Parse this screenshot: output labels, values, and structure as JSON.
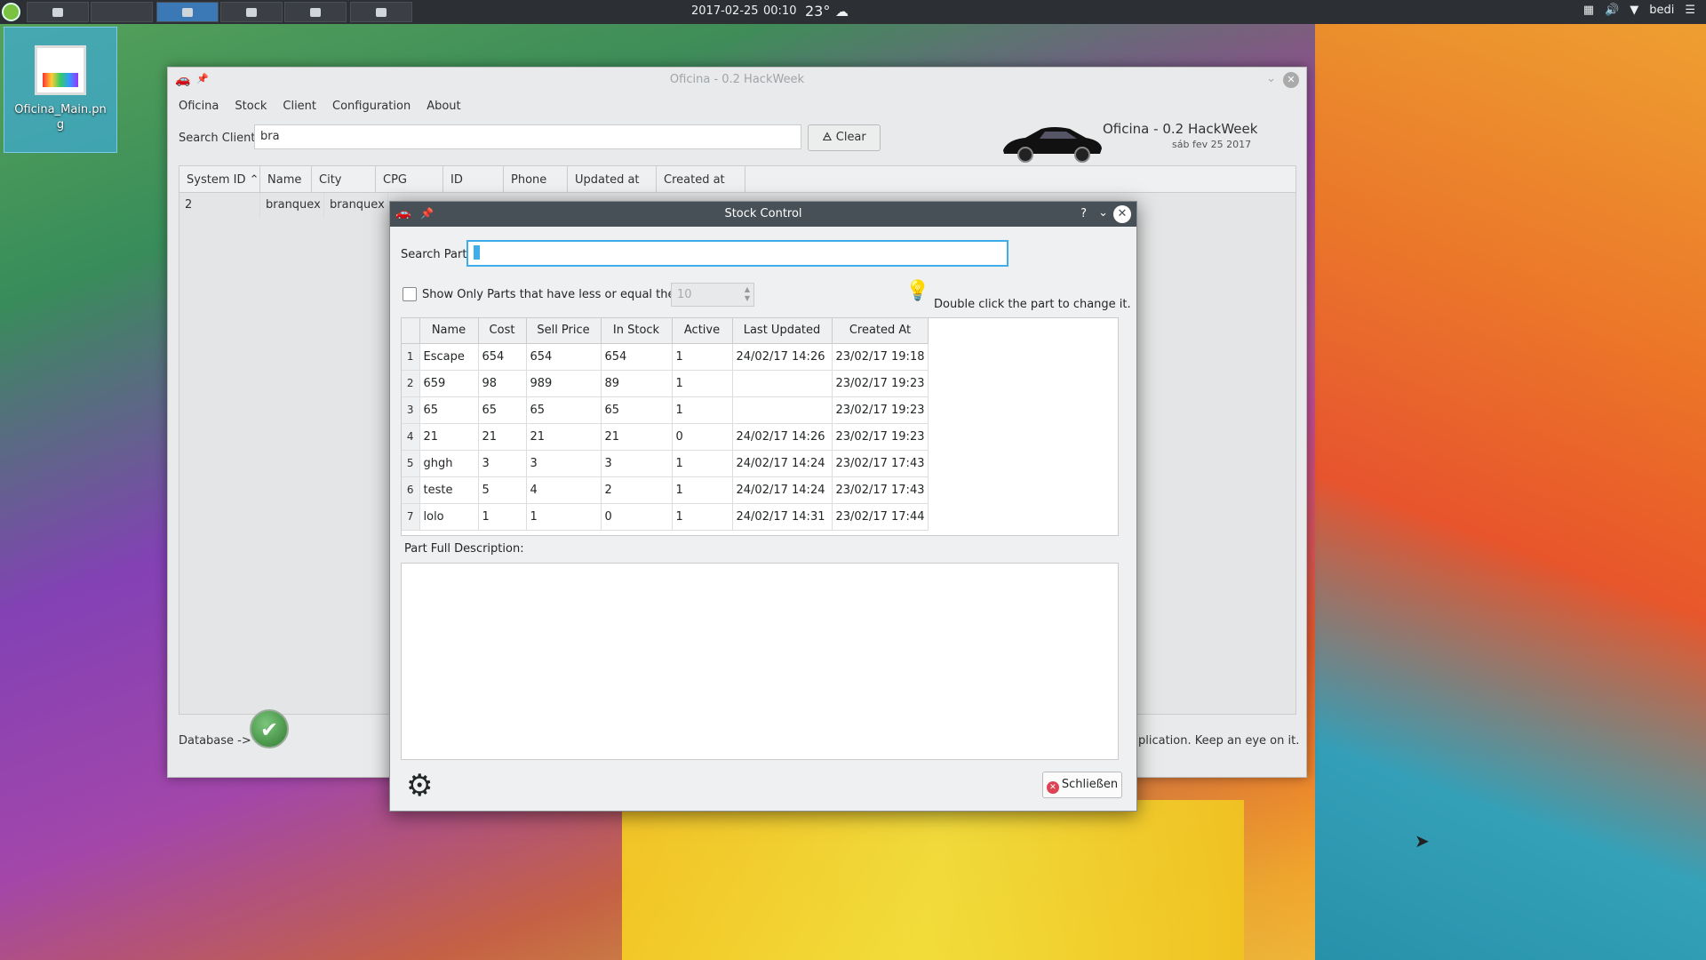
{
  "panel": {
    "date": "2017-02-25",
    "time": "00:10",
    "temperature": "23°",
    "user": "bedi"
  },
  "desktop": {
    "icon_label": "Oficina_Main.png"
  },
  "main_window": {
    "title": "Oficina - 0.2 HackWeek",
    "menu": [
      "Oficina",
      "Stock",
      "Client",
      "Configuration",
      "About"
    ],
    "search_label": "Search Client",
    "search_value": "bra",
    "clear_label": "Clear",
    "app_title": "Oficina - 0.2 HackWeek",
    "app_date": "sáb fev 25 2017",
    "client_columns": [
      "System ID",
      "Name",
      "City",
      "CPG",
      "ID",
      "Phone",
      "Updated at",
      "Created at"
    ],
    "client_rows": [
      [
        "2",
        "branquex",
        "branquex"
      ]
    ],
    "database_label": "Database ->",
    "status_message": "plication. Keep an eye on it."
  },
  "dialog": {
    "title": "Stock Control",
    "help": "?",
    "search_label": "Search Part",
    "search_value": "",
    "filter_label": "Show Only Parts that have less or equal then:",
    "filter_value": "10",
    "hint": "Double click the part to change it.",
    "columns": [
      "Name",
      "Cost",
      "Sell Price",
      "In Stock",
      "Active",
      "Last Updated",
      "Created At"
    ],
    "rows": [
      [
        "1",
        "Escape",
        "654",
        "654",
        "654",
        "1",
        "24/02/17 14:26",
        "23/02/17 19:18"
      ],
      [
        "2",
        "659",
        "98",
        "989",
        "89",
        "1",
        "",
        "23/02/17 19:23"
      ],
      [
        "3",
        "65",
        "65",
        "65",
        "65",
        "1",
        "",
        "23/02/17 19:23"
      ],
      [
        "4",
        "21",
        "21",
        "21",
        "21",
        "0",
        "24/02/17 14:26",
        "23/02/17 19:23"
      ],
      [
        "5",
        "ghgh",
        "3",
        "3",
        "3",
        "1",
        "24/02/17 14:24",
        "23/02/17 17:43"
      ],
      [
        "6",
        "teste",
        "5",
        "4",
        "2",
        "1",
        "24/02/17 14:24",
        "23/02/17 17:43"
      ],
      [
        "7",
        "lolo",
        "1",
        "1",
        "0",
        "1",
        "24/02/17 14:31",
        "23/02/17 17:44"
      ]
    ],
    "description_label": "Part Full Description:",
    "close_label": "Schließen"
  }
}
